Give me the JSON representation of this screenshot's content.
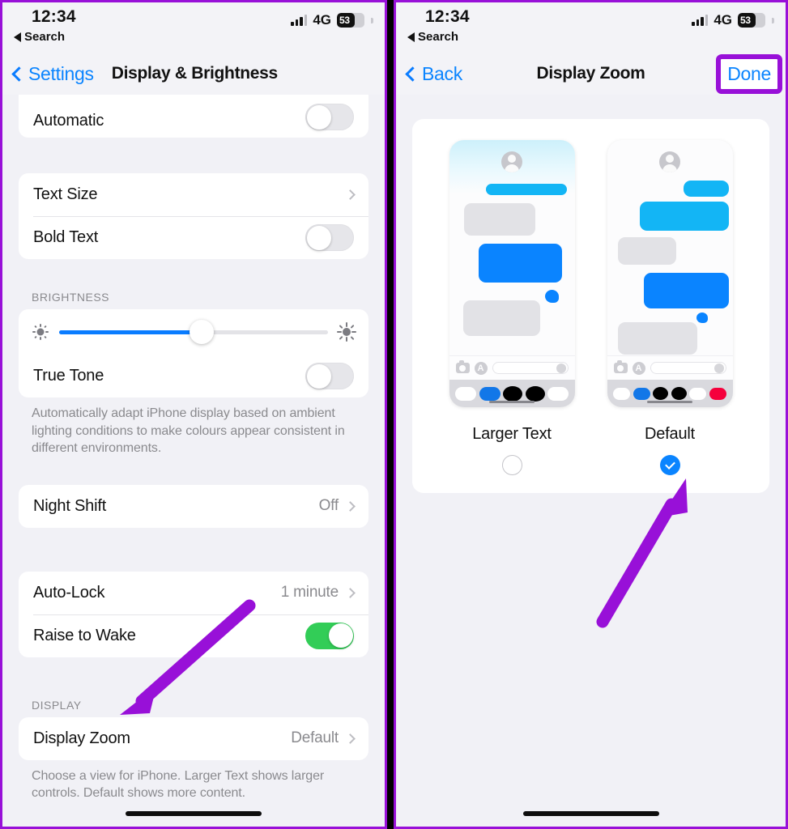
{
  "accent": {
    "ios_blue": "#0a84ff",
    "green": "#32cd57",
    "annotation_purple": "#9810d8"
  },
  "status_bar": {
    "time": "12:34",
    "back_app": "Search",
    "network": "4G",
    "battery_percent": "53"
  },
  "left_panel": {
    "nav": {
      "back_label": "Settings",
      "title": "Display & Brightness"
    },
    "appearance": {
      "rows": [
        {
          "label": "Automatic",
          "control": "toggle",
          "state": "off"
        }
      ]
    },
    "text_group": {
      "rows": [
        {
          "label": "Text Size",
          "control": "chevron",
          "value": ""
        },
        {
          "label": "Bold Text",
          "control": "toggle",
          "state": "off"
        }
      ]
    },
    "brightness": {
      "section_header": "BRIGHTNESS",
      "slider_value_percent": 53,
      "rows": [
        {
          "label": "True Tone",
          "control": "toggle",
          "state": "off"
        }
      ],
      "footnote": "Automatically adapt iPhone display based on ambient lighting conditions to make colours appear consistent in different environments."
    },
    "night_shift": {
      "rows": [
        {
          "label": "Night Shift",
          "value": "Off",
          "control": "chevron"
        }
      ]
    },
    "lock_group": {
      "rows": [
        {
          "label": "Auto-Lock",
          "value": "1 minute",
          "control": "chevron"
        },
        {
          "label": "Raise to Wake",
          "control": "toggle",
          "state": "on"
        }
      ]
    },
    "display_group": {
      "section_header": "DISPLAY",
      "rows": [
        {
          "label": "Display Zoom",
          "value": "Default",
          "control": "chevron"
        }
      ],
      "footnote": "Choose a view for iPhone. Larger Text shows larger controls. Default shows more content."
    }
  },
  "right_panel": {
    "nav": {
      "back_label": "Back",
      "title": "Display Zoom",
      "done_label": "Done"
    },
    "options": [
      {
        "label": "Larger Text",
        "selected": false
      },
      {
        "label": "Default",
        "selected": true
      }
    ]
  }
}
